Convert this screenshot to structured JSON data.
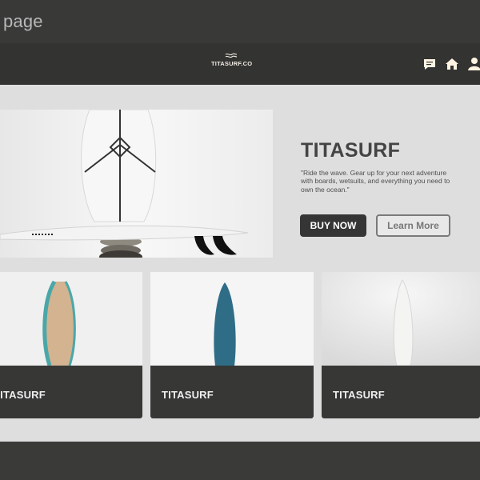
{
  "window": {
    "title": "page"
  },
  "nav": {
    "logo_text": "TITASURF.CO",
    "icons": [
      "chat-icon",
      "home-icon",
      "user-icon"
    ]
  },
  "hero": {
    "title": "TITASURF",
    "quote": "\"Ride the wave. Gear up for your next adventure with boards, wetsuits, and everything you need to own the ocean.\"",
    "buy_label": "BUY NOW",
    "learn_label": "Learn More"
  },
  "products": [
    {
      "name": "TITASURF",
      "board_color": "#d4b390",
      "rail_color": "#4aa7a8"
    },
    {
      "name": "TITASURF",
      "board_color": "#2f6d87",
      "rail_color": "#2f6d87"
    },
    {
      "name": "TITASURF",
      "board_color": "#f4f4f2",
      "rail_color": "#d7d7d7"
    }
  ]
}
